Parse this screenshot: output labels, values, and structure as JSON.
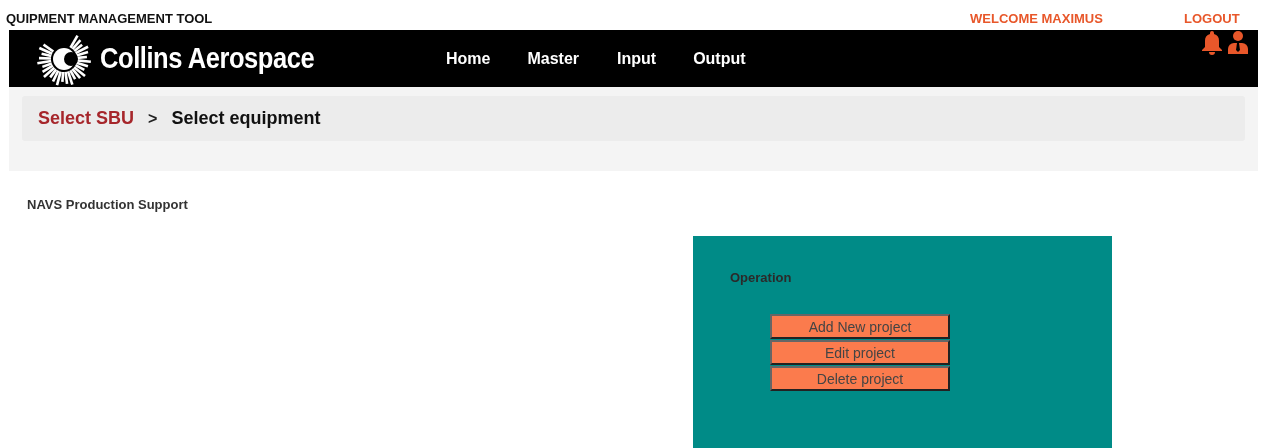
{
  "app_title": "QUIPMENT MANAGEMENT TOOL",
  "user_links": [
    "WELCOME MAXIMUS",
    "LOGOUT"
  ],
  "brand": "Collins Aerospace",
  "nav": [
    {
      "label": "Home"
    },
    {
      "label": "Master"
    },
    {
      "label": "Input"
    },
    {
      "label": "Output"
    }
  ],
  "breadcrumb": [
    {
      "label": "Select SBU",
      "kind": "link"
    },
    {
      "label": ">",
      "kind": "separator"
    },
    {
      "label": "Select equipment",
      "kind": "current"
    }
  ],
  "section_title": "NAVS Production Support",
  "panel": {
    "title": "Operation",
    "buttons": [
      "Add New project",
      "Edit project",
      "Delete project"
    ]
  }
}
